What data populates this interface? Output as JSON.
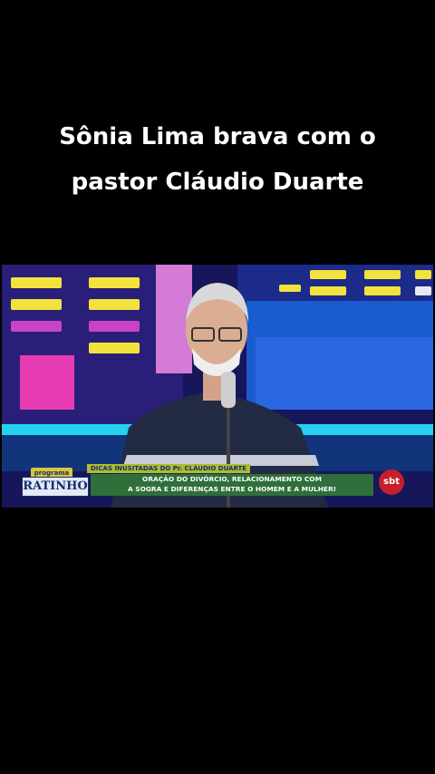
{
  "caption": {
    "line1": "Sônia Lima brava com o",
    "line2": "pastor Cláudio Duarte"
  },
  "video": {
    "show_logo_top": "programa do",
    "show_logo": "RATINHO",
    "tag": "DICAS INUSITADAS DO Pr. CLÁUDIO DUARTE",
    "headline_line1": "ORAÇÃO DO DIVÓRCIO, RELACIONAMENTO COM",
    "headline_line2": "A SOGRA E DIFERENÇAS ENTRE O HOMEM E A MULHER!",
    "channel": "sbt"
  },
  "colors": {
    "background": "#000000",
    "caption": "#ffffff",
    "stage": "#1a1a5e",
    "headline_bar": "#2f6f3a",
    "channel_badge": "#c51f2b"
  }
}
